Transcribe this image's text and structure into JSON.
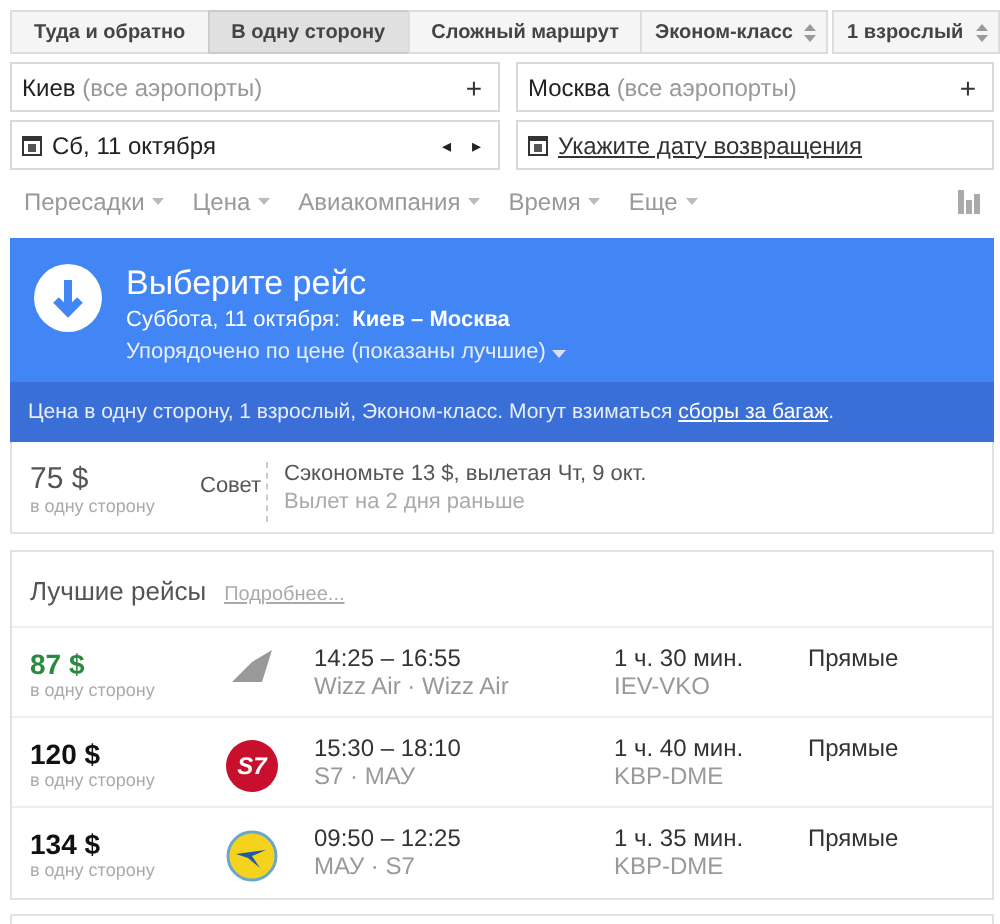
{
  "trip_types": [
    {
      "label": "Туда и обратно",
      "selected": false
    },
    {
      "label": "В одну сторону",
      "selected": true
    },
    {
      "label": "Сложный маршрут",
      "selected": false
    }
  ],
  "selects": [
    "Эконом-класс",
    "1 взрослый"
  ],
  "origin": {
    "city": "Киев",
    "note": "(все аэропорты)",
    "action": "+"
  },
  "destination": {
    "city": "Москва",
    "note": "(все аэропорты)",
    "action": "+"
  },
  "depart_date": {
    "value": "Сб, 11 октября",
    "prev": "◂",
    "next": "▸"
  },
  "return_date": {
    "link": "Укажите дату возвращения"
  },
  "filters": [
    "Пересадки",
    "Цена",
    "Авиакомпания",
    "Время",
    "Еще"
  ],
  "banner": {
    "title": "Выберите рейс",
    "date": "Суббота, 11 октября:",
    "route": "Киев – Москва",
    "sort": "Упорядочено по цене (показаны лучшие)",
    "note": "Цена в одну сторону, 1 взрослый, Эконом-класс. Могут взиматься",
    "note_link": "сборы за багаж",
    "note_end": "."
  },
  "tip": {
    "price": "75 $",
    "price_sub": "в одну сторону",
    "label": "Совет",
    "line1": "Сэкономьте 13 $, вылетая Чт, 9 окт.",
    "line2": "Вылет на 2 дня раньше"
  },
  "best": {
    "title": "Лучшие рейсы",
    "more": "Подробнее..."
  },
  "flights": [
    {
      "price": "87 $",
      "cheapest": true,
      "price_sub": "в одну сторону",
      "kind": "tail",
      "times": "14:25 – 16:55",
      "airlines": "Wizz Air · Wizz Air",
      "duration": "1 ч. 30 мин.",
      "airports": "IEV-VKO",
      "stops": "Прямые"
    },
    {
      "price": "120 $",
      "cheapest": false,
      "price_sub": "в одну сторону",
      "kind": "badge",
      "logo_text": "S7",
      "times": "15:30 – 18:10",
      "airlines": "S7 · МАУ",
      "duration": "1 ч. 40 мин.",
      "airports": "KBP-DME",
      "stops": "Прямые"
    },
    {
      "price": "134 $",
      "cheapest": false,
      "price_sub": "в одну сторону",
      "kind": "bird",
      "times": "09:50 – 12:25",
      "airlines": "МАУ · S7",
      "duration": "1 ч. 35 мин.",
      "airports": "KBP-DME",
      "stops": "Прямые"
    }
  ]
}
